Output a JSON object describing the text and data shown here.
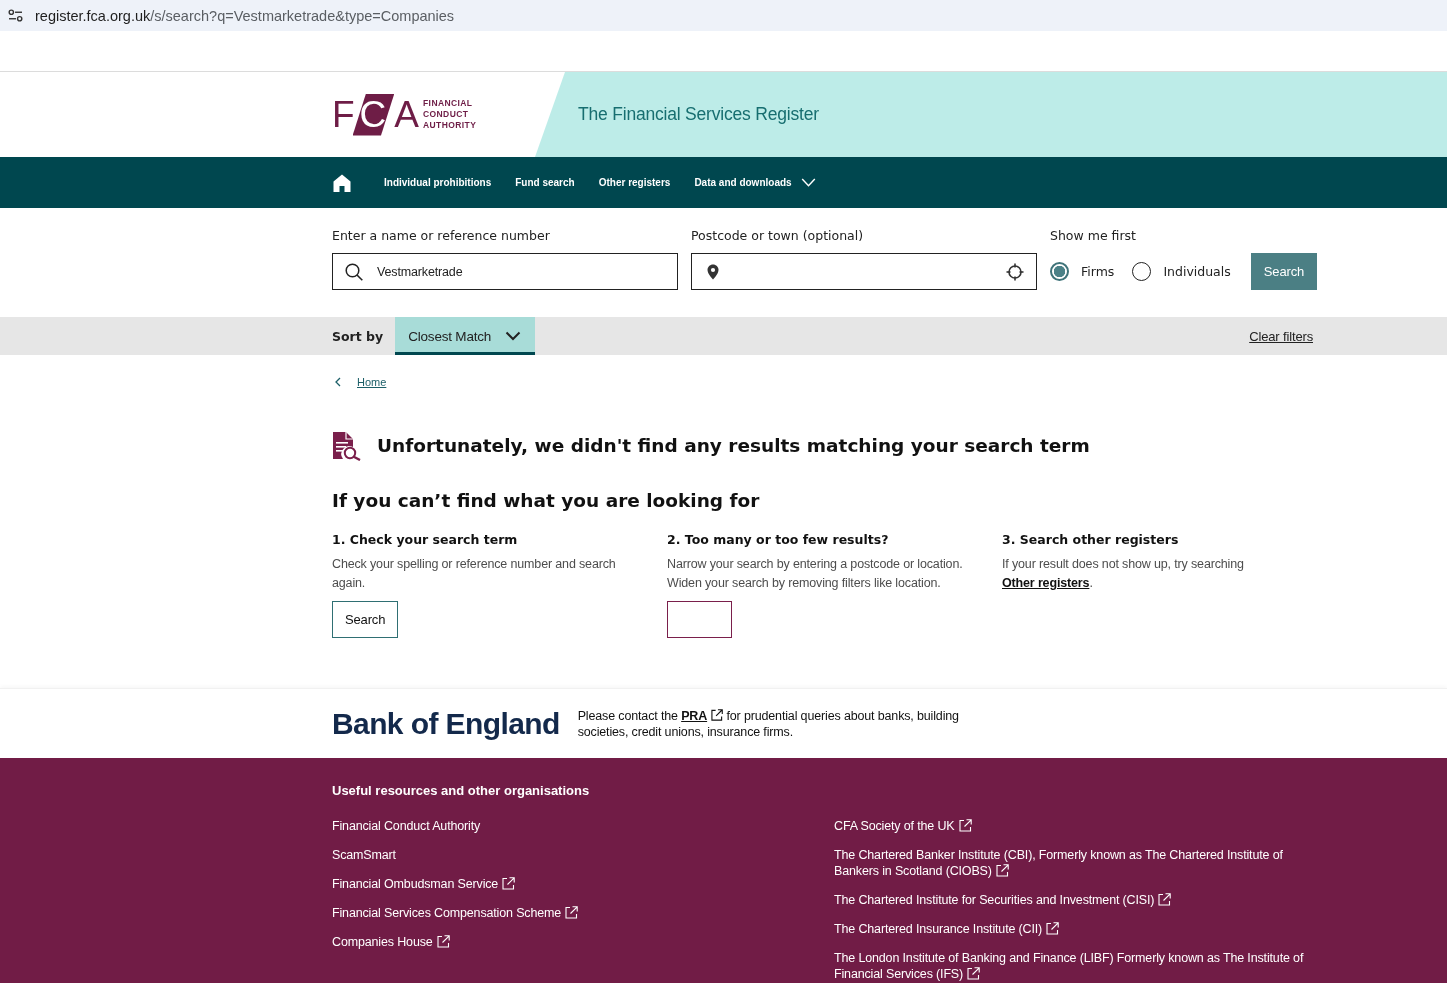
{
  "browser": {
    "host": "register.fca.org.uk",
    "path": "/s/search?q=Vestmarketrade&type=Companies"
  },
  "header": {
    "logo": {
      "letters": [
        "F",
        "C",
        "A"
      ],
      "wordmark": [
        "FINANCIAL",
        "CONDUCT",
        "AUTHORITY"
      ]
    },
    "title": "The Financial Services Register"
  },
  "nav": {
    "items": [
      {
        "label": "Individual prohibitions",
        "kind": "link"
      },
      {
        "label": "Fund search",
        "kind": "link"
      },
      {
        "label": "Other registers",
        "kind": "link"
      },
      {
        "label": "Data and downloads",
        "kind": "dropdown"
      }
    ]
  },
  "search": {
    "name_label": "Enter a name or reference number",
    "name_value": "Vestmarketrade",
    "location_label": "Postcode or town (optional)",
    "show_first_label": "Show me first",
    "options": [
      {
        "label": "Firms",
        "selected": true
      },
      {
        "label": "Individuals",
        "selected": false
      }
    ],
    "button": "Search"
  },
  "sort": {
    "label": "Sort by",
    "value": "Closest Match",
    "clear": "Clear filters"
  },
  "breadcrumb": {
    "back": "Home"
  },
  "notice": "Unfortunately, we didn't find any results matching your search term",
  "help": {
    "title": "If you can’t find what you are looking for",
    "columns": [
      {
        "heading": "1. Check your search term",
        "paragraphs": [
          {
            "text": "Check your spelling or reference number and search again."
          }
        ],
        "action": {
          "kind": "button",
          "label": "Search"
        }
      },
      {
        "heading": "2. Too many or too few results?",
        "paragraphs": [
          {
            "text": "Narrow your search by entering a postcode or location."
          },
          {
            "text": "Widen your search by removing filters like location."
          }
        ],
        "action": {
          "kind": "blank"
        }
      },
      {
        "heading": "3. Search other registers",
        "paragraphs": [
          {
            "text": "If your result does not show up, try searching",
            "link": "Other registers",
            "after": "."
          }
        ]
      }
    ]
  },
  "partner": {
    "logo": "Bank of England",
    "before": "Please contact the",
    "link": "PRA",
    "after": "for prudential queries about banks, building societies, credit unions, insurance firms."
  },
  "footer": {
    "heading": "Useful resources and other organisations",
    "left_links": [
      {
        "label": "Financial Conduct Authority",
        "external": false
      },
      {
        "label": "ScamSmart",
        "external": false
      },
      {
        "label": "Financial Ombudsman Service",
        "external": true
      },
      {
        "label": "Financial Services Compensation Scheme",
        "external": true
      },
      {
        "label": "Companies House",
        "external": true
      }
    ],
    "right_links": [
      {
        "label": "CFA Society of the UK",
        "external": true
      },
      {
        "label": "The Chartered Banker Institute (CBI), Formerly known as The Chartered Institute of Bankers in Scotland (CIOBS)",
        "external": true
      },
      {
        "label": "The Chartered Institute for Securities and Investment (CISI)",
        "external": true
      },
      {
        "label": "The Chartered Insurance Institute (CII)",
        "external": true
      },
      {
        "label": "The London Institute of Banking and Finance (LIBF) Formerly known as The Institute of Financial Services (IFS)",
        "external": true
      }
    ]
  }
}
